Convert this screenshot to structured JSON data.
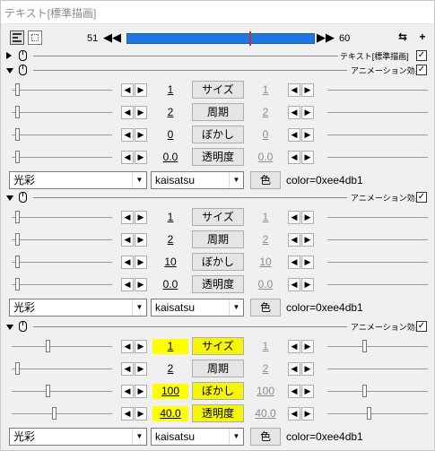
{
  "window": {
    "title": "テキスト[標準描画]"
  },
  "toolbar": {
    "start_frame": "51",
    "end_frame": "60",
    "prev": "◀◀",
    "next": "▶▶",
    "icon_r1": "⇆",
    "icon_r2": "+"
  },
  "header_text": {
    "label": "テキスト[標準描画]",
    "checked": "✓"
  },
  "groups": [
    {
      "label": "アニメーション効果",
      "checked": "✓",
      "rows": [
        {
          "name": "サイズ",
          "left": "1",
          "right": "1"
        },
        {
          "name": "周期",
          "left": "2",
          "right": "2"
        },
        {
          "name": "ぼかし",
          "left": "0",
          "right": "0"
        },
        {
          "name": "透明度",
          "left": "0.0",
          "right": "0.0"
        }
      ],
      "effect": "光彩",
      "script": "kaisatsu",
      "color_btn": "色",
      "color_val": "color=0xee4db1"
    },
    {
      "label": "アニメーション効果",
      "checked": "✓",
      "rows": [
        {
          "name": "サイズ",
          "left": "1",
          "right": "1"
        },
        {
          "name": "周期",
          "left": "2",
          "right": "2"
        },
        {
          "name": "ぼかし",
          "left": "10",
          "right": "10"
        },
        {
          "name": "透明度",
          "left": "0.0",
          "right": "0.0"
        }
      ],
      "effect": "光彩",
      "script": "kaisatsu",
      "color_btn": "色",
      "color_val": "color=0xee4db1"
    },
    {
      "label": "アニメーション効果",
      "checked": "✓",
      "rows": [
        {
          "name": "サイズ",
          "left": "1",
          "right": "1"
        },
        {
          "name": "周期",
          "left": "2",
          "right": "2"
        },
        {
          "name": "ぼかし",
          "left": "100",
          "right": "100"
        },
        {
          "name": "透明度",
          "left": "40.0",
          "right": "40.0"
        }
      ],
      "effect": "光彩",
      "script": "kaisatsu",
      "color_btn": "色",
      "color_val": "color=0xee4db1"
    }
  ],
  "arrows": {
    "left": "◀",
    "right": "▶"
  },
  "highlight_color": "#ffff00",
  "seek_color": "#1f76e0"
}
